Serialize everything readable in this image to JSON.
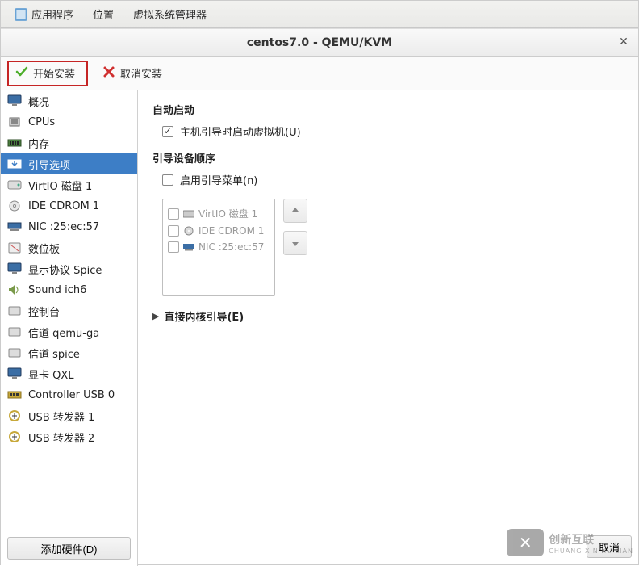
{
  "menubar": {
    "apps": "应用程序",
    "location": "位置",
    "vmm": "虚拟系统管理器"
  },
  "titlebar": {
    "title": "centos7.0 - QEMU/KVM"
  },
  "toolbar": {
    "start_install": "开始安装",
    "cancel_install": "取消安装"
  },
  "sidebar": {
    "items": [
      {
        "label": "概况",
        "icon": "monitor",
        "selected": false
      },
      {
        "label": "CPUs",
        "icon": "cpu",
        "selected": false
      },
      {
        "label": "内存",
        "icon": "memory",
        "selected": false
      },
      {
        "label": "引导选项",
        "icon": "boot",
        "selected": true
      },
      {
        "label": "VirtIO 磁盘 1",
        "icon": "disk",
        "selected": false
      },
      {
        "label": "IDE CDROM 1",
        "icon": "cdrom",
        "selected": false
      },
      {
        "label": "NIC :25:ec:57",
        "icon": "nic",
        "selected": false
      },
      {
        "label": "数位板",
        "icon": "tablet",
        "selected": false
      },
      {
        "label": "显示协议 Spice",
        "icon": "display",
        "selected": false
      },
      {
        "label": "Sound ich6",
        "icon": "sound",
        "selected": false
      },
      {
        "label": "控制台",
        "icon": "console",
        "selected": false
      },
      {
        "label": "信道 qemu-ga",
        "icon": "channel",
        "selected": false
      },
      {
        "label": "信道 spice",
        "icon": "channel",
        "selected": false
      },
      {
        "label": "显卡 QXL",
        "icon": "video",
        "selected": false
      },
      {
        "label": "Controller USB 0",
        "icon": "usb-ctrl",
        "selected": false
      },
      {
        "label": "USB 转发器 1",
        "icon": "usb",
        "selected": false
      },
      {
        "label": "USB 转发器 2",
        "icon": "usb",
        "selected": false
      }
    ],
    "add_hw": "添加硬件(D)"
  },
  "panel": {
    "autostart_title": "自动启动",
    "autostart_checkbox": {
      "checked": true,
      "label": "主机引导时启动虚拟机(U)"
    },
    "boot_order_title": "引导设备顺序",
    "enable_boot_menu": {
      "checked": false,
      "label": "启用引导菜单(n)"
    },
    "boot_devices": [
      {
        "label": "VirtIO 磁盘 1",
        "icon": "disk",
        "checked": false
      },
      {
        "label": "IDE CDROM 1",
        "icon": "cdrom",
        "checked": false
      },
      {
        "label": "NIC :25:ec:57",
        "icon": "nic",
        "checked": false
      }
    ],
    "direct_kernel_title": "直接内核引导(E)"
  },
  "footer": {
    "cancel": "取消"
  },
  "watermark": {
    "brand": "创新互联",
    "sub": "CHUANG XIN HU LIAN"
  }
}
